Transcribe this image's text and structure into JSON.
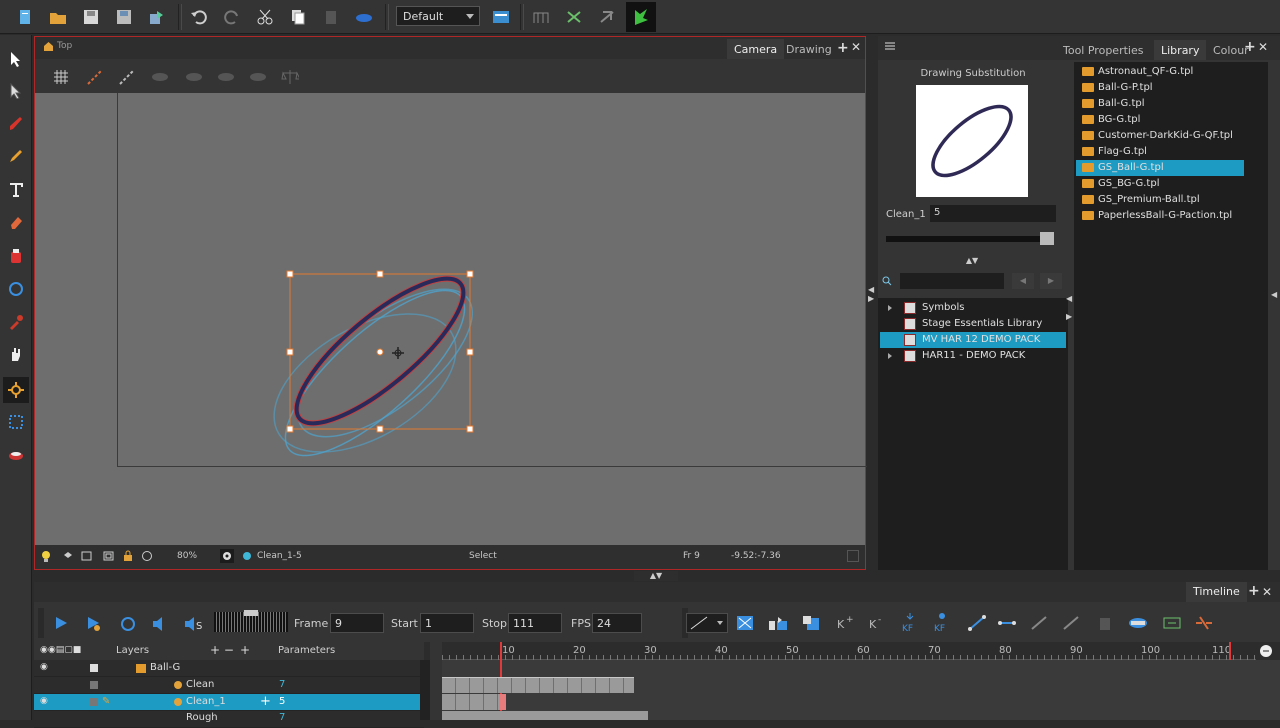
{
  "toolbar": {
    "workspace": "Default",
    "icons": [
      "new-scene-icon",
      "open-icon",
      "save-icon",
      "save-all-icon",
      "import-icon",
      "undo-icon",
      "redo-icon",
      "cut-icon",
      "copy-icon",
      "paste-icon",
      "brush-icon",
      "workspace-icon",
      "tool1-icon",
      "tool2-icon",
      "tool3-icon",
      "harmony-icon"
    ]
  },
  "camera_view": {
    "breadcrumb": "Top",
    "tabs": [
      "Camera",
      "Drawing"
    ],
    "active_tab": "Camera",
    "status": {
      "zoom": "80%",
      "drawing": "Clean_1-5",
      "tool": "Select",
      "frame": "Fr 9",
      "coords": "-9.52:-7.36"
    }
  },
  "right_panel": {
    "tabs": [
      "Tool Properties",
      "Library",
      "Colour"
    ],
    "active_tab": "Library",
    "substitution_title": "Drawing Substitution",
    "cell_label": "Clean_1",
    "cell_value": "5",
    "templates": [
      "Astronaut_QF-G.tpl",
      "Ball-G-P.tpl",
      "Ball-G.tpl",
      "BG-G.tpl",
      "Customer-DarkKid-G-QF.tpl",
      "Flag-G.tpl",
      "GS_Ball-G.tpl",
      "GS_BG-G.tpl",
      "GS_Premium-Ball.tpl",
      "PaperlessBall-G-Paction.tpl"
    ],
    "selected_template": "GS_Ball-G.tpl",
    "library_tree": [
      {
        "label": "Symbols",
        "expandable": true
      },
      {
        "label": "Stage Essentials Library",
        "expandable": false
      },
      {
        "label": "MV HAR 12 DEMO PACK",
        "expandable": false
      },
      {
        "label": "HAR11 - DEMO PACK",
        "expandable": true
      }
    ],
    "selected_tree": "MV HAR 12 DEMO PACK"
  },
  "timeline": {
    "title": "Timeline",
    "frame_label": "Frame",
    "frame_value": "9",
    "start_label": "Start",
    "start_value": "1",
    "stop_label": "Stop",
    "stop_value": "111",
    "fps_label": "FPS",
    "fps_value": "24",
    "layers_header": "Layers",
    "params_header": "Parameters",
    "ticks": [
      "10",
      "20",
      "30",
      "40",
      "50",
      "60",
      "70",
      "80",
      "90",
      "100",
      "110"
    ],
    "layers": [
      {
        "name": "Ball-G",
        "param": "",
        "selected": false
      },
      {
        "name": "Clean",
        "param": "7",
        "selected": false
      },
      {
        "name": "Clean_1",
        "param": "5",
        "selected": true
      },
      {
        "name": "Rough",
        "param": "7",
        "selected": false
      }
    ]
  },
  "colors": {
    "accent": "#1e9bc2",
    "active_border": "#b02727",
    "stage_bg": "#6e6e6e",
    "line_color": "#2a2a5a",
    "onion_color": "#4fa3cc",
    "selection_box": "#e07a30"
  }
}
